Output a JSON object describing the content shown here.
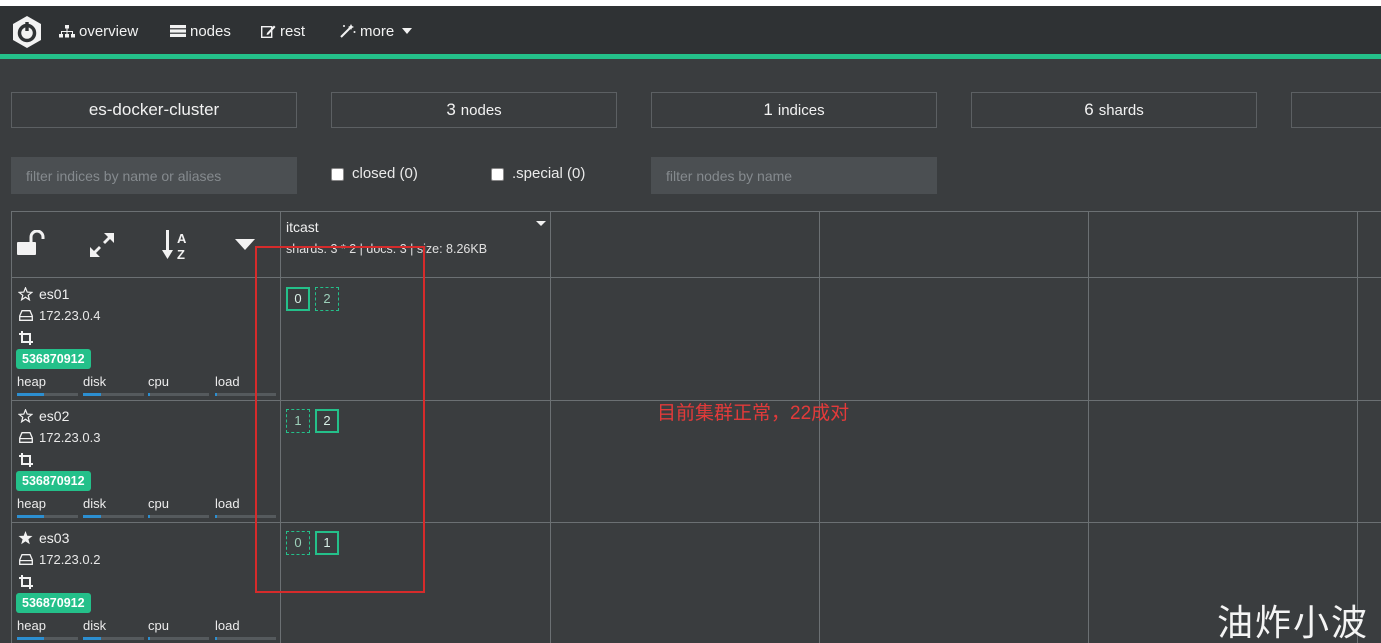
{
  "nav": {
    "overview_label": "overview",
    "nodes_label": "nodes",
    "rest_label": "rest",
    "more_label": "more",
    "icons": [
      "logo-icon",
      "sitemap-icon",
      "server-icon",
      "edit-icon",
      "magic-icon",
      "caret-down-icon"
    ]
  },
  "stats": {
    "cluster_name": "es-docker-cluster",
    "nodes_count": "3",
    "nodes_label": "nodes",
    "indices_count": "1",
    "indices_label": "indices",
    "shards_count": "6",
    "shards_label": "shards"
  },
  "filters": {
    "indices_placeholder": "filter indices by name or aliases",
    "closed_label": "closed (0)",
    "special_label": ".special (0)",
    "nodes_placeholder": "filter nodes by name"
  },
  "index": {
    "name": "itcast",
    "info": "shards: 3 * 2 | docs: 3 | size: 8.26KB"
  },
  "metric_labels": [
    "heap",
    "disk",
    "cpu",
    "load"
  ],
  "nodes": [
    {
      "name": "es01",
      "ip": "172.23.0.4",
      "badge": "536870912",
      "master": false,
      "metrics": [
        0.45,
        0.3,
        0.03,
        0.03
      ],
      "shards": [
        {
          "n": "0",
          "primary": true
        },
        {
          "n": "2",
          "primary": false
        }
      ]
    },
    {
      "name": "es02",
      "ip": "172.23.0.3",
      "badge": "536870912",
      "master": false,
      "metrics": [
        0.45,
        0.3,
        0.03,
        0.03
      ],
      "shards": [
        {
          "n": "1",
          "primary": false
        },
        {
          "n": "2",
          "primary": true
        }
      ]
    },
    {
      "name": "es03",
      "ip": "172.23.0.2",
      "badge": "536870912",
      "master": true,
      "metrics": [
        0.45,
        0.3,
        0.03,
        0.03
      ],
      "shards": [
        {
          "n": "0",
          "primary": false
        },
        {
          "n": "1",
          "primary": true
        }
      ]
    }
  ],
  "annotation": "目前集群正常，22成对",
  "watermark": "油炸小波",
  "colors": {
    "accent": "#24c08a",
    "annotation": "#d62b2b",
    "bar": "#2c8fd1",
    "background": "#3a3d3f"
  }
}
